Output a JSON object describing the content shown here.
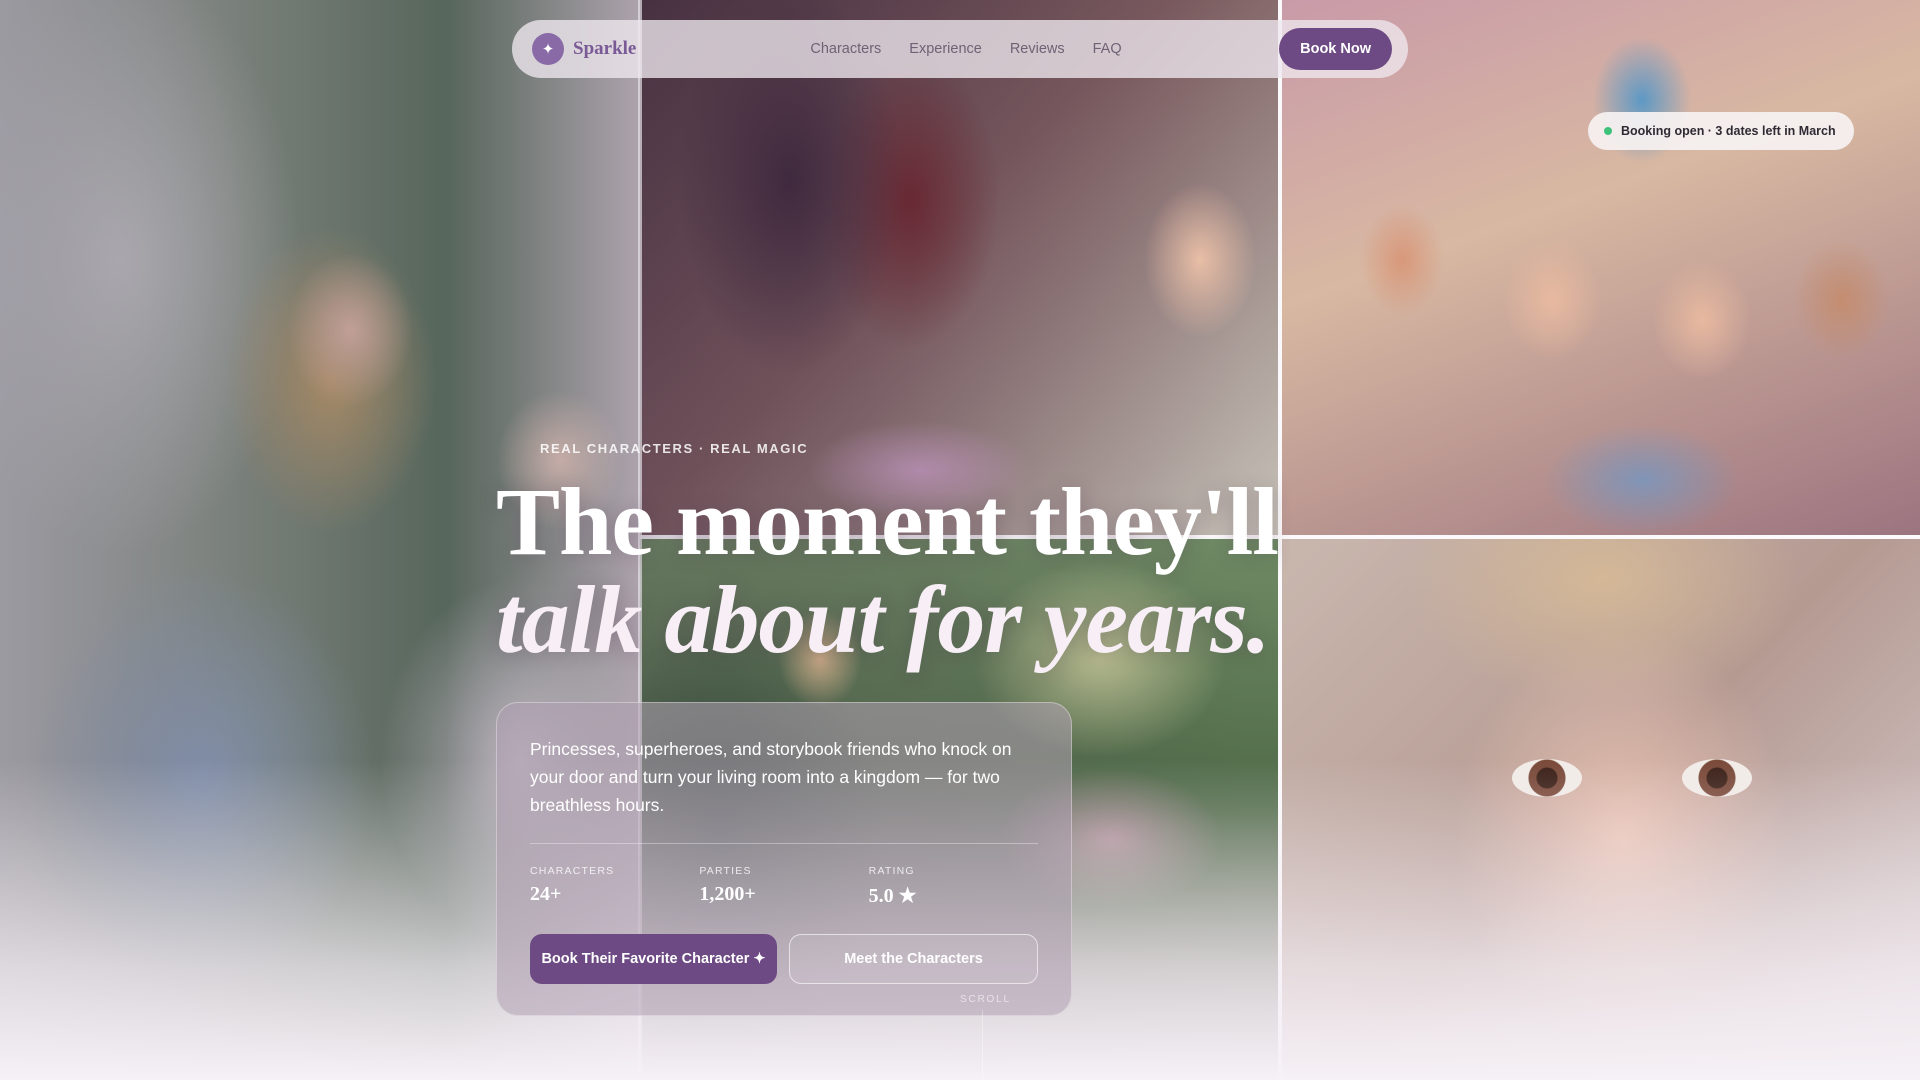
{
  "nav": {
    "brand_mark": "✦",
    "brand_name": "Sparkle",
    "links": [
      "Characters",
      "Experience",
      "Reviews",
      "FAQ"
    ],
    "cta_label": "Book Now"
  },
  "badge": {
    "text": "Booking open · 3 dates left in March",
    "status_color": "#3ec27a"
  },
  "hero": {
    "eyebrow": "REAL CHARACTERS · REAL MAGIC",
    "headline_line1": "The moment they'll",
    "headline_line2": "talk about for years.",
    "description": "Princesses, superheroes, and storybook friends who knock on your door and turn your living room into a kingdom — for two breathless hours.",
    "stats": [
      {
        "label": "CHARACTERS",
        "value": "24+"
      },
      {
        "label": "PARTIES",
        "value": "1,200+"
      },
      {
        "label": "RATING",
        "value": "5.0 ★"
      }
    ],
    "primary_cta": "Book Their Favorite Character ✦",
    "secondary_cta": "Meet the Characters",
    "scroll_label": "SCROLL"
  },
  "colors": {
    "accent": "#6d4a83",
    "brand_text": "#7a5a96"
  }
}
